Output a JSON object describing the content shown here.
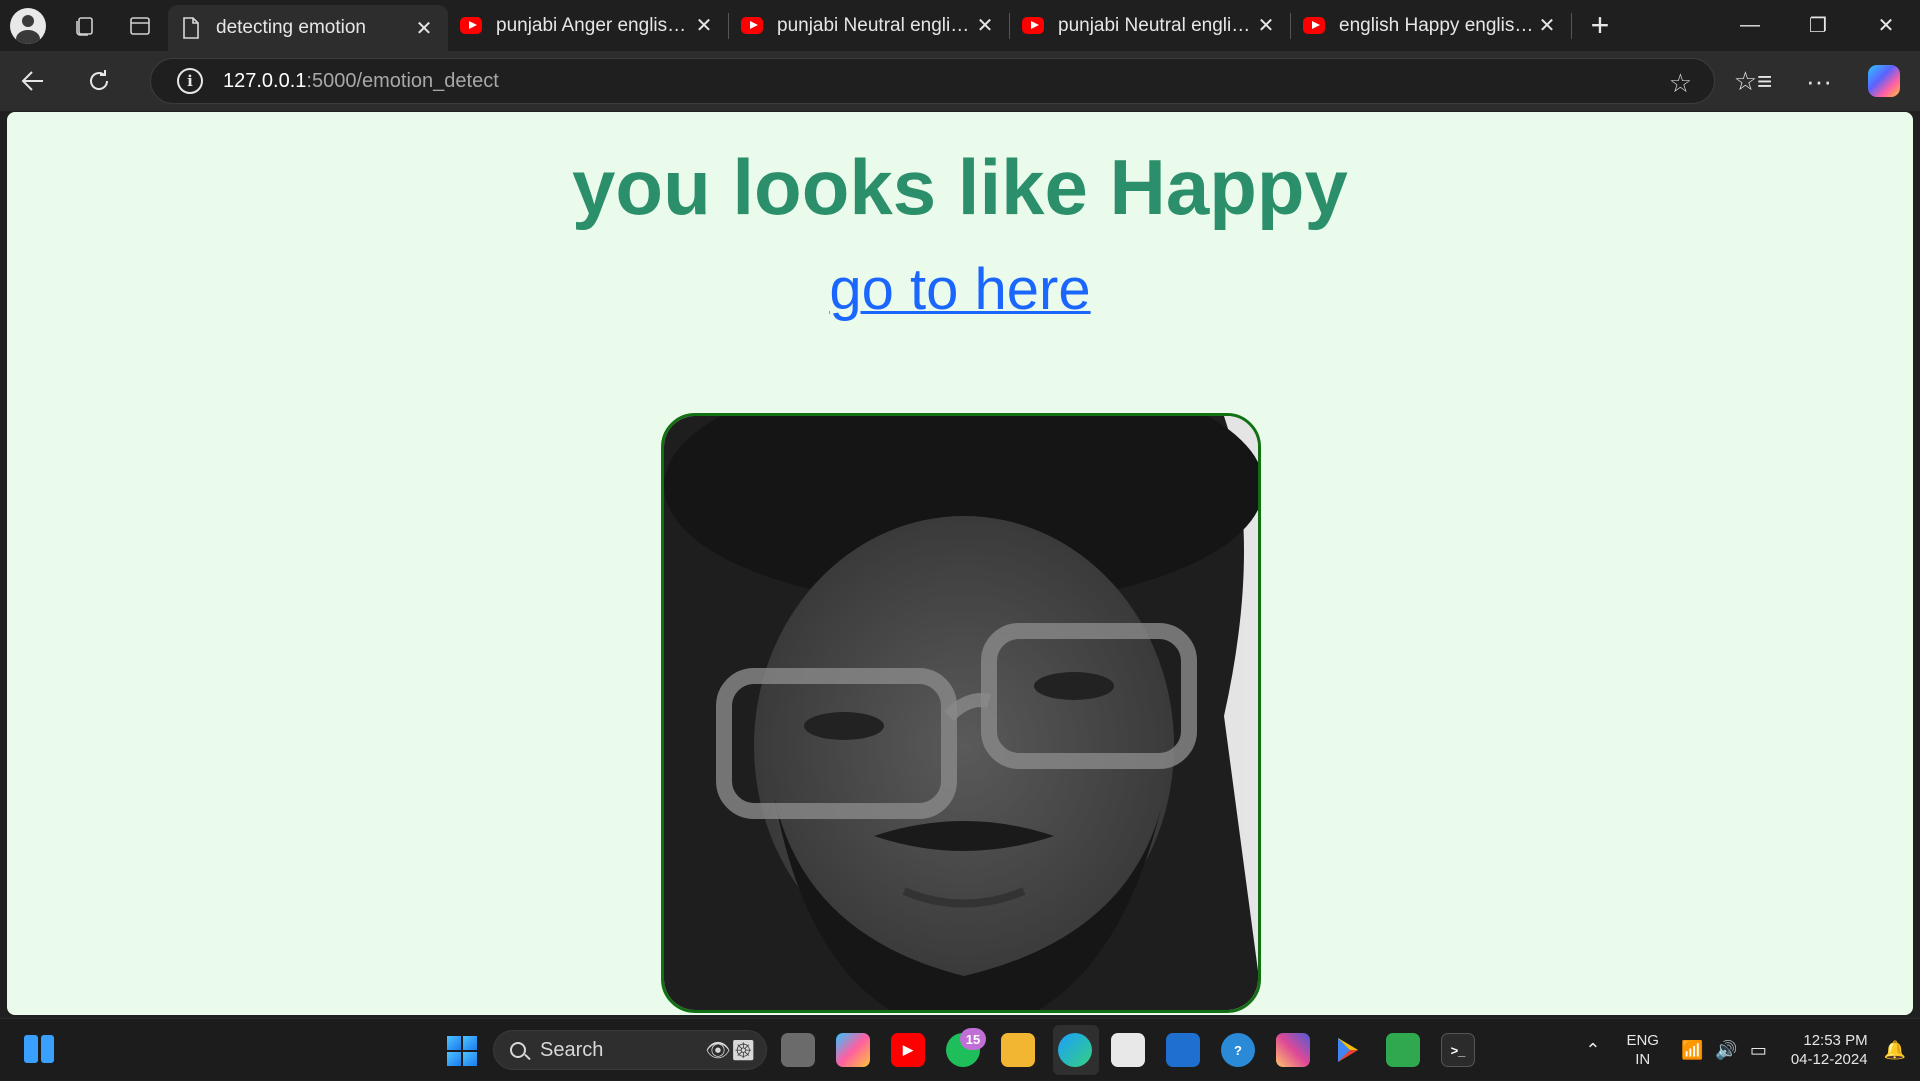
{
  "browser": {
    "tabs": [
      {
        "title": "detecting emotion",
        "icon": "document-icon",
        "active": true
      },
      {
        "title": "punjabi Anger english songs",
        "icon": "youtube-icon",
        "active": false
      },
      {
        "title": "punjabi Neutral english songs",
        "icon": "youtube-icon",
        "active": false
      },
      {
        "title": "punjabi Neutral english songs",
        "icon": "youtube-icon",
        "active": false
      },
      {
        "title": "english Happy english songs",
        "icon": "youtube-icon",
        "active": false
      }
    ],
    "url_host": "127.0.0.1",
    "url_path": ":5000/emotion_detect"
  },
  "page": {
    "heading": "you looks like Happy",
    "link_text": "go to here",
    "photo_alt": "detected face",
    "colors": {
      "heading": "#2a8f6a",
      "link": "#1a66ff",
      "background": "#ebfbeb",
      "photo_border": "#117011"
    }
  },
  "taskbar": {
    "search_placeholder": "Search",
    "whatsapp_badge": "15",
    "lang_top": "ENG",
    "lang_bottom": "IN",
    "time": "12:53 PM",
    "date": "04-12-2024"
  }
}
